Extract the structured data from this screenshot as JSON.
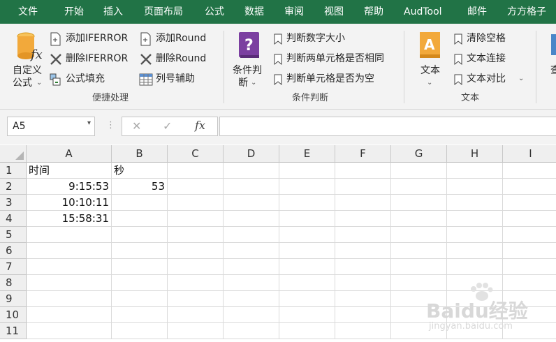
{
  "tabs": [
    "文件",
    "开始",
    "插入",
    "页面布局",
    "公式",
    "数据",
    "审阅",
    "视图",
    "帮助",
    "AudTool",
    "邮件",
    "方方格子"
  ],
  "ribbon": {
    "custom_fx": {
      "line1": "自定义",
      "line2": "公式"
    },
    "add_iferror": "添加IFERROR",
    "del_iferror": "删除IFERROR",
    "formula_fill": "公式填充",
    "add_round": "添加Round",
    "del_round": "删除Round",
    "col_assist": "列号辅助",
    "group_quick": "便捷处理",
    "cond_judge": {
      "line1": "条件判",
      "line2": "断"
    },
    "judge_num": "判断数字大小",
    "judge_same": "判断两单元格是否相同",
    "judge_empty": "判断单元格是否为空",
    "group_cond": "条件判断",
    "text_btn": "文本",
    "clear_space": "清除空格",
    "text_join": "文本连接",
    "text_compare": "文本对比",
    "group_text": "文本",
    "cut_label": "查"
  },
  "formula_bar": {
    "name_box": "A5",
    "cancel_icon": "✕",
    "enter_icon": "✓",
    "fx_label": "fx",
    "formula": ""
  },
  "columns": [
    "A",
    "B",
    "C",
    "D",
    "E",
    "F",
    "G",
    "H",
    "I"
  ],
  "rows": [
    "1",
    "2",
    "3",
    "4",
    "5",
    "6",
    "7",
    "8",
    "9",
    "10",
    "11"
  ],
  "cells": {
    "A1": "时间",
    "B1": "秒",
    "A2": "9:15:53",
    "B2": "53",
    "A3": "10:10:11",
    "A4": "15:58:31"
  },
  "watermark": {
    "brand": "Baidu经验",
    "url": "jingyan.baidu.com"
  },
  "colors": {
    "accent": "#217346",
    "purple": "#7b3fa0",
    "orange": "#f2a93b"
  }
}
